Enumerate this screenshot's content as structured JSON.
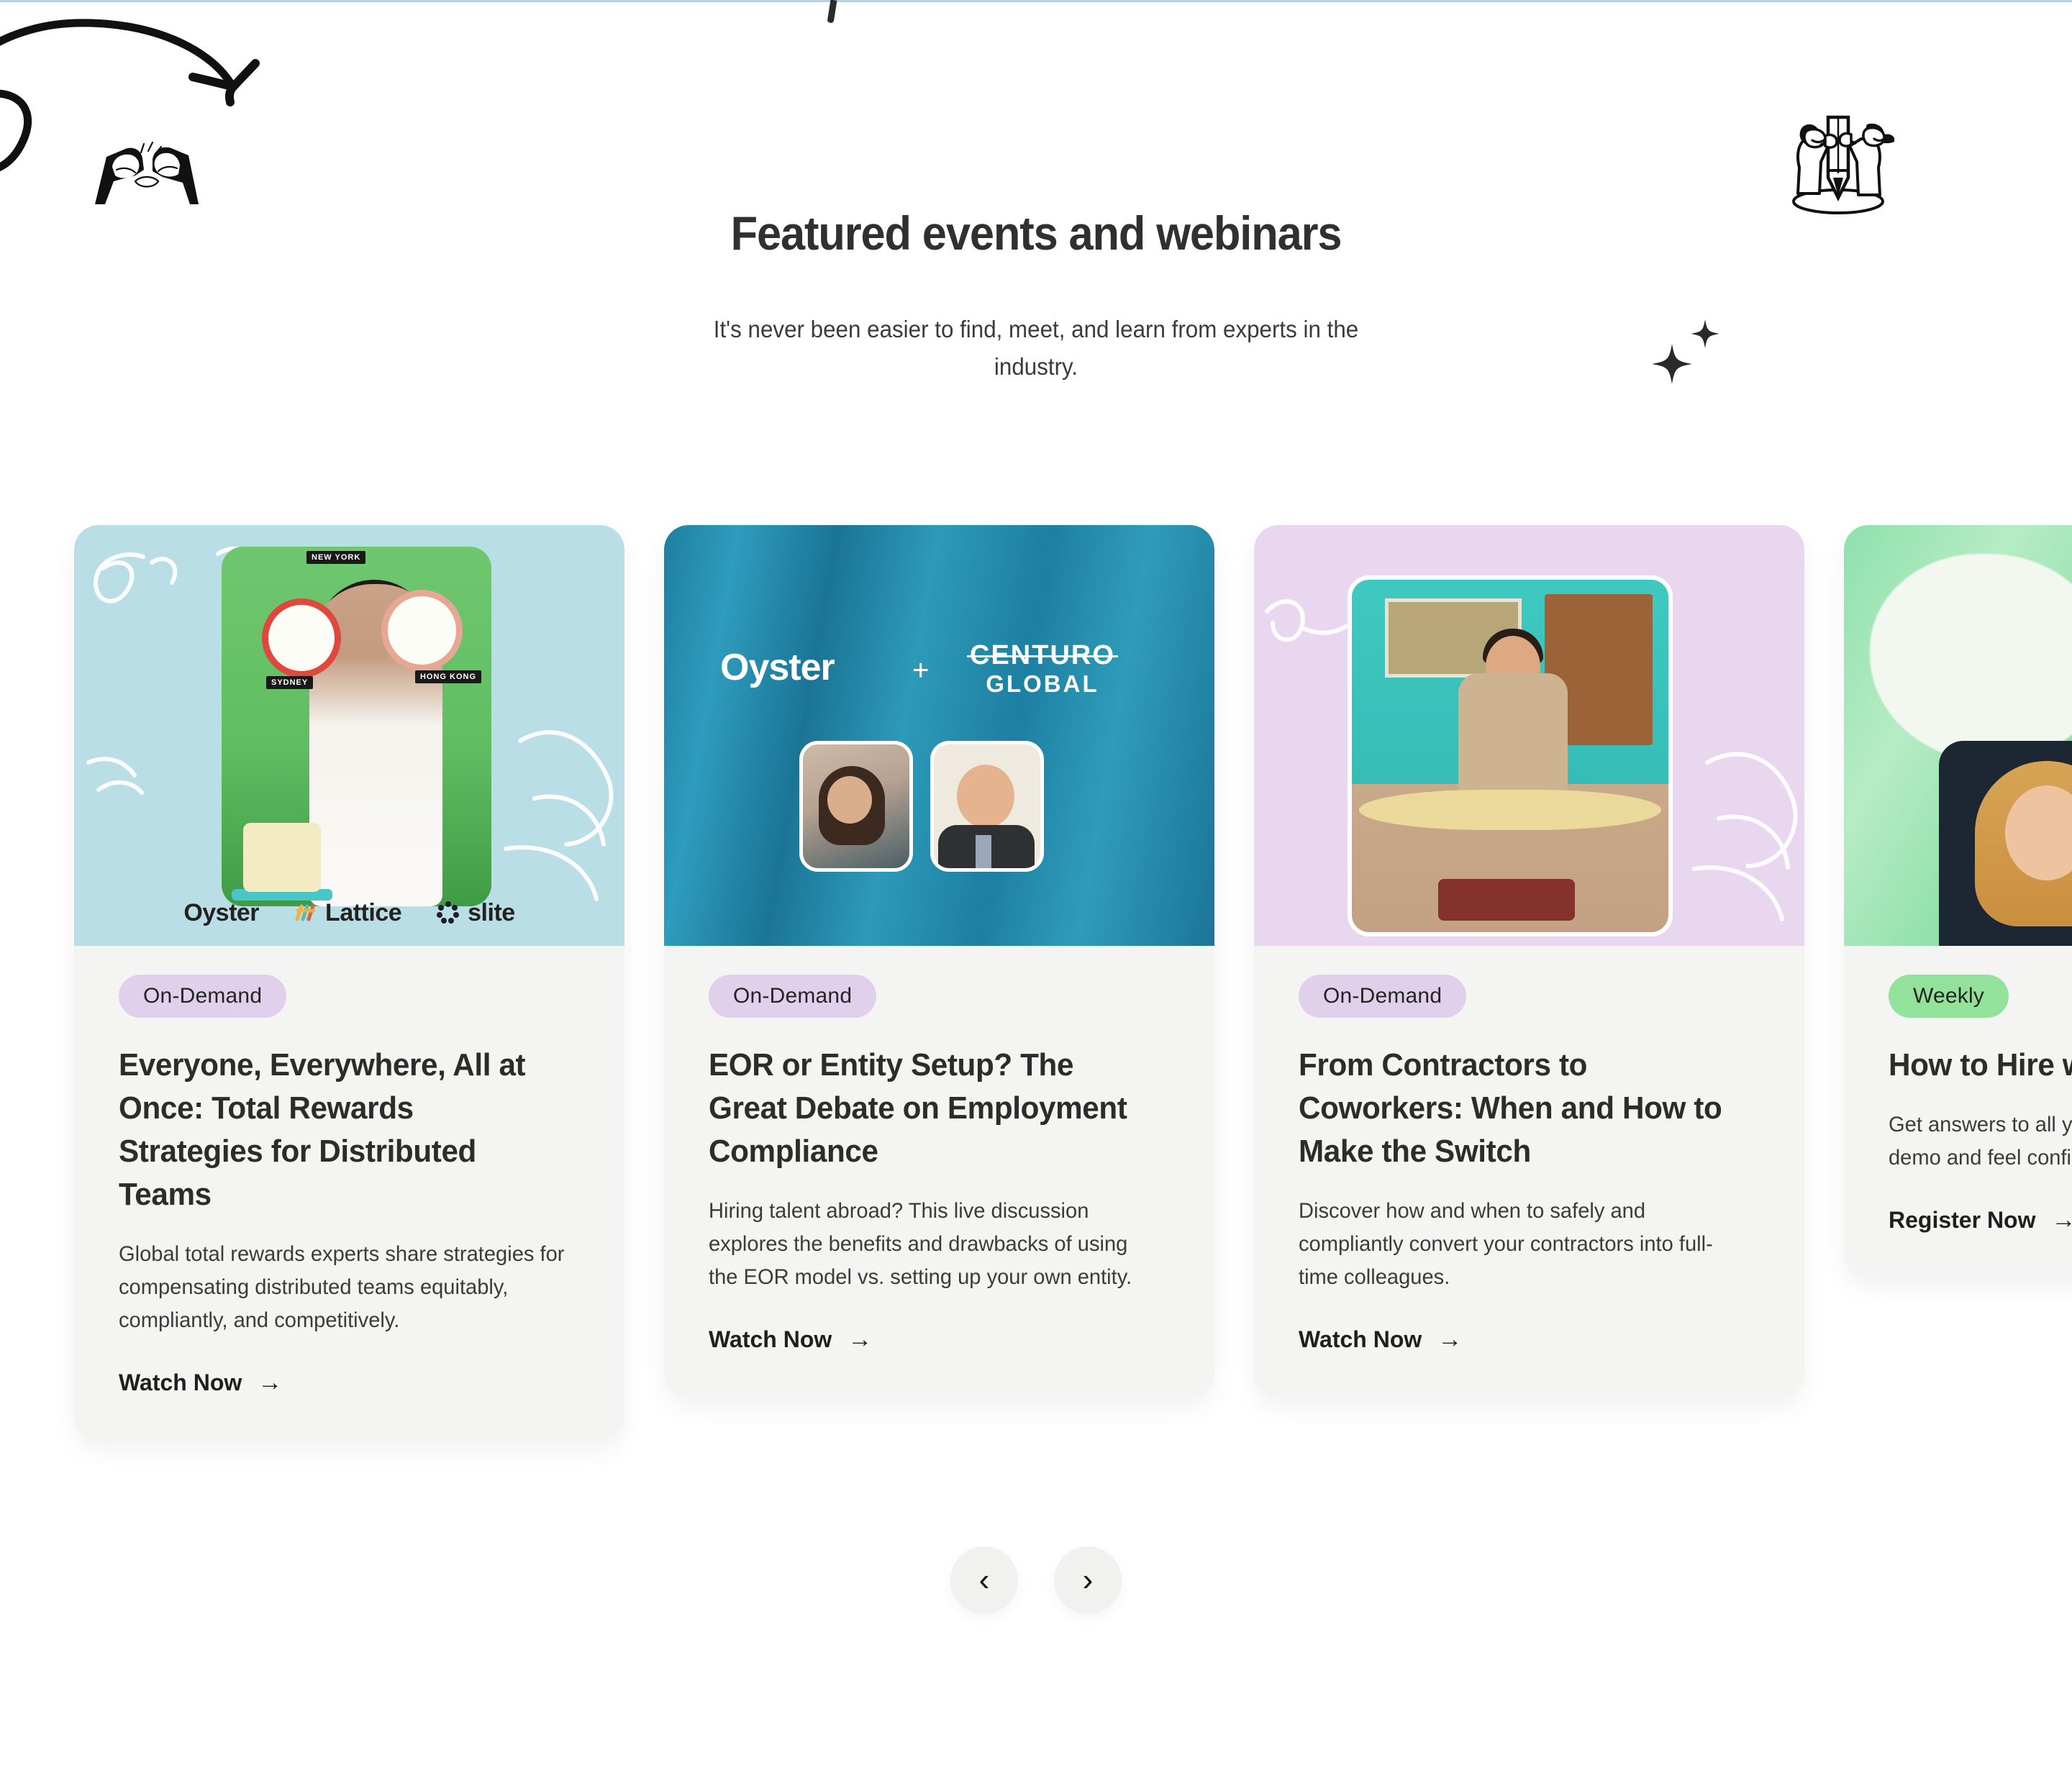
{
  "header": {
    "title": "Featured events and webinars",
    "subtitle": "It's never been easier to find, meet, and learn from experts in the industry."
  },
  "carousel": {
    "prev_label": "‹",
    "next_label": "›",
    "cards": [
      {
        "badge": "On-Demand",
        "badge_color": "#e0d0ec",
        "title": "Everyone, Everywhere, All at Once: Total Rewards Strategies for Distributed Teams",
        "description": "Global total rewards experts share strategies for compensating distributed teams equitably, compliantly, and competitively.",
        "cta": "Watch Now",
        "cta_arrow": "→",
        "media_bg": "#b9dee6",
        "media_logos": [
          "Oyster",
          "Lattice",
          "slite"
        ]
      },
      {
        "badge": "On-Demand",
        "badge_color": "#e0d0ec",
        "title": "EOR or Entity Setup? The Great Debate on Employment Compliance",
        "description": "Hiring talent abroad? This live discussion explores the benefits and drawbacks of using the EOR model vs. setting up your own entity.",
        "cta": "Watch Now",
        "cta_arrow": "→",
        "media_bg": "#2b93b3",
        "media_brand_left": "Oyster",
        "media_brand_plus": "+",
        "media_brand_right_line1": "CENTURO",
        "media_brand_right_line2": "GLOBAL"
      },
      {
        "badge": "On-Demand",
        "badge_color": "#e0d0ec",
        "title": "From Contractors to Coworkers: When and How to Make the Switch",
        "description": "Discover how and when to safely and compliantly convert your contractors into full-time colleagues.",
        "cta": "Watch Now",
        "cta_arrow": "→",
        "media_bg": "#e8d7ef"
      },
      {
        "badge": "Weekly",
        "badge_color": "#93e29b",
        "title": "How to Hire with Oyster",
        "description": "Get answers to all your questions in our quick demo and feel confident hiring.",
        "cta": "Register Now",
        "cta_arrow": "→",
        "media_bg": "#9ce4b0"
      }
    ]
  },
  "decorations": {
    "arrow_swirl": "curved-arrow-doodle",
    "arm_wrestle": "arm-wrestling-doodle",
    "pencil_people": "people-with-pencil-doodle",
    "sparkles": "sparkle-doodle"
  }
}
